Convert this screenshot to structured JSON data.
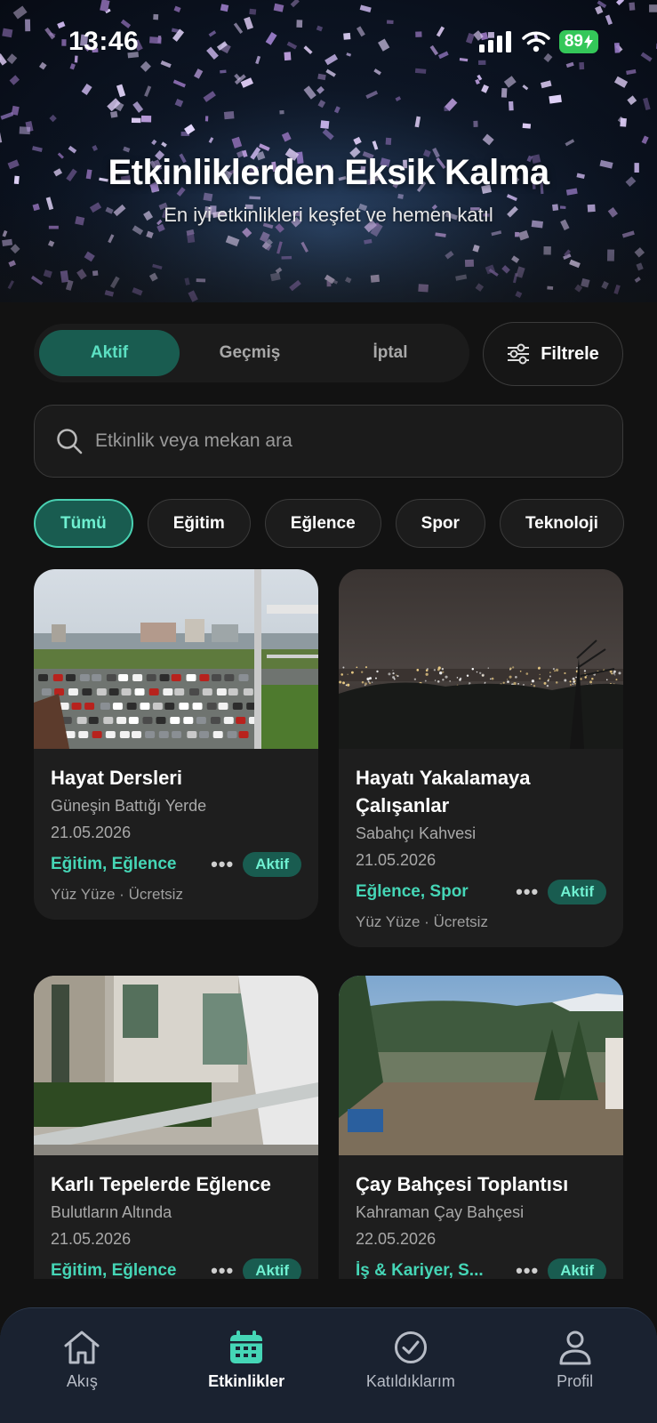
{
  "status_bar": {
    "time": "13:46",
    "battery": "89"
  },
  "hero": {
    "title": "Etkinliklerden Eksik Kalma",
    "subtitle": "En iyi etkinlikleri keşfet ve hemen katıl"
  },
  "segments": [
    "Aktif",
    "Geçmiş",
    "İptal"
  ],
  "filter_label": "Filtrele",
  "search": {
    "placeholder": "Etkinlik veya mekan ara"
  },
  "categories": [
    "Tümü",
    "Eğitim",
    "Eğlence",
    "Spor",
    "Teknoloji"
  ],
  "events": [
    {
      "title": "Hayat Dersleri",
      "venue": "Güneşin Battığı Yerde",
      "date": "21.05.2026",
      "categories": "Eğitim, Eğlence",
      "status": "Aktif",
      "meta": "Yüz Yüze · Ücretsiz"
    },
    {
      "title": "Hayatı Yakalamaya Çalışanlar",
      "venue": "Sabahçı Kahvesi",
      "date": "21.05.2026",
      "categories": "Eğlence, Spor",
      "status": "Aktif",
      "meta": "Yüz Yüze · Ücretsiz"
    },
    {
      "title": "Karlı Tepelerde Eğlence",
      "venue": "Bulutların Altında",
      "date": "21.05.2026",
      "categories": "Eğitim, Eğlence",
      "status": "Aktif",
      "meta": ""
    },
    {
      "title": "Çay Bahçesi Toplantısı",
      "venue": "Kahraman Çay Bahçesi",
      "date": "22.05.2026",
      "categories": "İş & Kariyer, S...",
      "status": "Aktif",
      "meta": ""
    }
  ],
  "tabs": [
    {
      "label": "Akış",
      "icon": "home-icon"
    },
    {
      "label": "Etkinlikler",
      "icon": "calendar-icon"
    },
    {
      "label": "Katıldıklarım",
      "icon": "check-circle-icon"
    },
    {
      "label": "Profil",
      "icon": "person-icon"
    }
  ],
  "colors": {
    "accent": "#45d6b6",
    "accent_bg": "#195c50",
    "background": "#121212",
    "card": "#1e1e1e",
    "tabbar": "#1a2230"
  }
}
